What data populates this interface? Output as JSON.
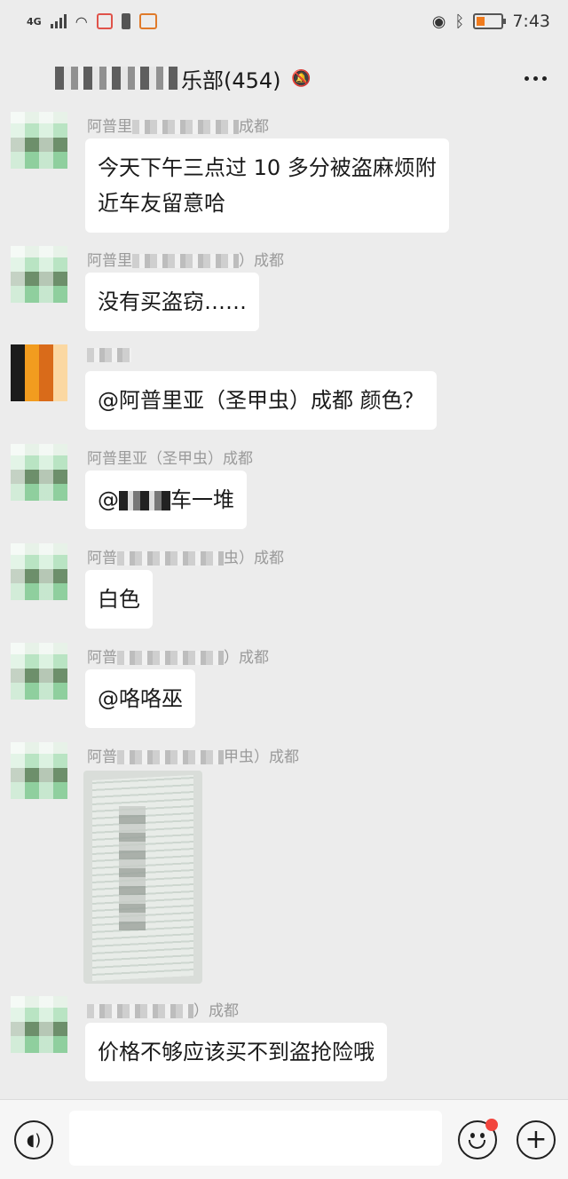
{
  "status_bar": {
    "network": "4G",
    "time": "7:43",
    "battery_color": "#f07b1d",
    "icons": [
      "signal-icon",
      "wifi-icon",
      "notification-icon",
      "warning-icon",
      "video-icon",
      "eye-icon",
      "bluetooth-icon",
      "battery-icon"
    ]
  },
  "header": {
    "title": "乐部(454)",
    "mute_icon": "bell-off-icon",
    "more_icon": "more-icon"
  },
  "messages": [
    {
      "sender_prefix": "阿普里",
      "sender_suffix": "成都",
      "text_lines": [
        "今天下午三点过 10 多分被盗麻烦附",
        "近车友留意哈"
      ]
    },
    {
      "sender_prefix": "阿普里",
      "sender_suffix": "）成都",
      "text_lines": [
        "没有买盗窃……"
      ]
    },
    {
      "sender_prefix": "",
      "sender_suffix": "",
      "text_lines": [
        "@阿普里亚（圣甲虫）成都  颜色？"
      ]
    },
    {
      "sender_prefix": "阿普里亚（圣甲虫）成都",
      "sender_suffix": "",
      "text_lines": [
        "@",
        "车一堆"
      ]
    },
    {
      "sender_prefix": "阿普",
      "sender_suffix": "虫）成都",
      "text_lines": [
        "白色"
      ]
    },
    {
      "sender_prefix": "阿普",
      "sender_suffix": "）成都",
      "text_lines": [
        "@咯咯巫"
      ]
    },
    {
      "sender_prefix": "阿普",
      "sender_suffix": "甲虫）成都",
      "image": true
    },
    {
      "sender_prefix": "",
      "sender_suffix": "）成都",
      "text_lines": [
        "价格不够应该买不到盗抢险哦"
      ]
    }
  ],
  "input_bar": {
    "placeholder": "",
    "voice_icon": "voice-icon",
    "emoji_icon": "emoji-icon",
    "plus_icon": "plus-icon",
    "badge_color": "#f2453d"
  }
}
